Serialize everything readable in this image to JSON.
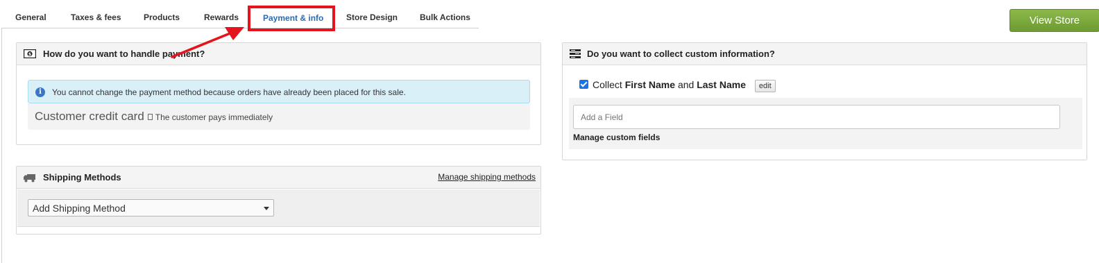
{
  "tabs": [
    {
      "label": "General"
    },
    {
      "label": "Taxes & fees"
    },
    {
      "label": "Products"
    },
    {
      "label": "Rewards"
    },
    {
      "label": "Payment & info"
    },
    {
      "label": "Store Design"
    },
    {
      "label": "Bulk Actions"
    }
  ],
  "active_tab": "Payment & info",
  "view_store": "View Store",
  "payment": {
    "title": "How do you want to handle payment?",
    "alert": "You cannot change the payment method because orders have already been placed for this sale.",
    "alert_icon": "i",
    "method": "Customer credit card",
    "method_desc": "The customer pays immediately"
  },
  "shipping": {
    "title": "Shipping Methods",
    "manage_link": "Manage shipping methods",
    "select_value": "Add Shipping Method"
  },
  "custom_info": {
    "title": "Do you want to collect custom information?",
    "collect_prefix": "Collect",
    "first_name": "First Name",
    "and": "and",
    "last_name": "Last Name",
    "checked": true,
    "edit_label": "edit",
    "add_field_placeholder": "Add a Field",
    "manage_fields": "Manage custom fields"
  },
  "colors": {
    "accent": "#2a6ab3",
    "highlight": "#e3141b",
    "view_store_bg": "#7aa83c",
    "alert_bg": "#d9f0f8"
  }
}
